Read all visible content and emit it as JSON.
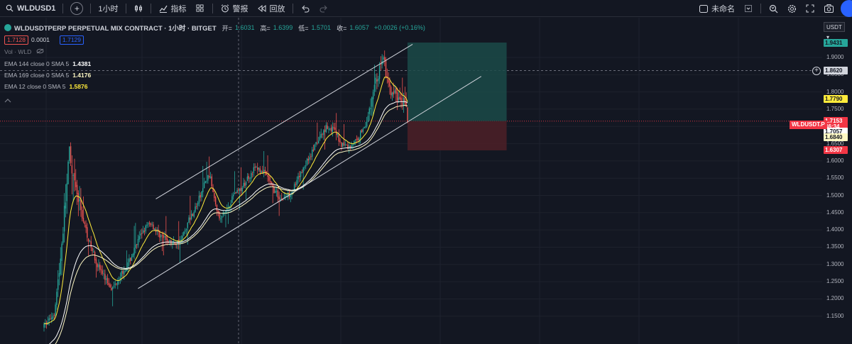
{
  "toolbar": {
    "symbol": "WLDUSD1",
    "interval": "1小时",
    "indicators_label": "指标",
    "alert_label": "警报",
    "replay_label": "回放",
    "layout_name": "未命名"
  },
  "legend": {
    "title": "WLDUSDTPERP PERPETUAL MIX CONTRACT · 1小时 · BITGET",
    "open_label": "开=",
    "open": "1.6031",
    "high_label": "高=",
    "high": "1.6399",
    "low_label": "低=",
    "low": "1.5701",
    "close_label": "收=",
    "close": "1.6057",
    "change": "+0.0026 (+0.16%)",
    "sell_price": "1.7128",
    "spread": "0.0001",
    "buy_price": "1.7129",
    "volume_label": "Vol · WLD",
    "indicators": [
      {
        "text": "EMA 144 close 0 SMA 5",
        "value": "1.4381",
        "color": "#ffffff"
      },
      {
        "text": "EMA 169 close 0 SMA 5",
        "value": "1.4176",
        "color": "#fff9c4"
      },
      {
        "text": "EMA 12 close 0 SMA 5",
        "value": "1.5876",
        "color": "#ffeb3b"
      }
    ]
  },
  "price_axis": {
    "currency": "USDT",
    "ticks": [
      "1.9000",
      "1.8500",
      "1.8000",
      "1.7500",
      "1.6500",
      "1.6000",
      "1.5500",
      "1.5000",
      "1.4500",
      "1.4000",
      "1.3500",
      "1.3000",
      "1.2500",
      "1.2000",
      "1.1500"
    ],
    "labels": [
      {
        "text": "1.9431",
        "bg": "#26a69a",
        "fg": "#131722",
        "y": 1.9431
      },
      {
        "text": "1.8620",
        "bg": "#d1d4dc",
        "fg": "#131722",
        "y": 1.862
      },
      {
        "text": "1.7790",
        "bg": "#ffeb3b",
        "fg": "#131722",
        "y": 1.779
      },
      {
        "text": "1.7157",
        "bg": "#787b86",
        "fg": "#ffffff",
        "y": 1.7157
      },
      {
        "text": "1.7153",
        "bg": "#f23645",
        "fg": "#ffffff",
        "y": 1.7153
      },
      {
        "text": "46:34",
        "bg": "#f23645",
        "fg": "#ffffff",
        "y": 1.7
      },
      {
        "text": "1.7057",
        "bg": "#ffffff",
        "fg": "#131722",
        "y": 1.685
      },
      {
        "text": "1.6840",
        "bg": "#fff9c4",
        "fg": "#131722",
        "y": 1.6695
      },
      {
        "text": "1.6307",
        "bg": "#f23645",
        "fg": "#ffffff",
        "y": 1.6307
      }
    ],
    "symbol_tag": "WLDUSDT.P"
  },
  "colors": {
    "background": "#131722",
    "up": "#26a69a",
    "down": "#ef5350",
    "ema12": "#ffeb3b",
    "ema144": "#ffffff",
    "ema169": "#fff9c4",
    "target_zone": "#1b4a48",
    "stop_zone": "#4a1f27"
  },
  "chart_data": {
    "type": "candlestick",
    "title": "WLDUSDTPERP PERPETUAL MIX CONTRACT · 1小时 · BITGET",
    "ylim": [
      1.12,
      1.99
    ],
    "price_trend": [
      [
        0,
        1.12
      ],
      [
        8,
        1.16
      ],
      [
        12,
        1.28
      ],
      [
        16,
        1.45
      ],
      [
        20,
        1.62
      ],
      [
        22,
        1.55
      ],
      [
        26,
        1.5
      ],
      [
        30,
        1.44
      ],
      [
        36,
        1.36
      ],
      [
        42,
        1.3
      ],
      [
        48,
        1.26
      ],
      [
        54,
        1.23
      ],
      [
        60,
        1.27
      ],
      [
        66,
        1.3
      ],
      [
        72,
        1.35
      ],
      [
        78,
        1.4
      ],
      [
        84,
        1.42
      ],
      [
        90,
        1.39
      ],
      [
        96,
        1.37
      ],
      [
        102,
        1.36
      ],
      [
        108,
        1.37
      ],
      [
        114,
        1.43
      ],
      [
        120,
        1.47
      ],
      [
        126,
        1.53
      ],
      [
        130,
        1.56
      ],
      [
        134,
        1.5
      ],
      [
        138,
        1.43
      ],
      [
        144,
        1.46
      ],
      [
        150,
        1.51
      ],
      [
        156,
        1.52
      ],
      [
        160,
        1.55
      ],
      [
        166,
        1.58
      ],
      [
        172,
        1.57
      ],
      [
        176,
        1.55
      ],
      [
        180,
        1.52
      ],
      [
        186,
        1.49
      ],
      [
        192,
        1.5
      ],
      [
        198,
        1.53
      ],
      [
        204,
        1.58
      ],
      [
        210,
        1.62
      ],
      [
        216,
        1.66
      ],
      [
        222,
        1.7
      ],
      [
        228,
        1.69
      ],
      [
        234,
        1.65
      ],
      [
        240,
        1.64
      ],
      [
        246,
        1.66
      ],
      [
        252,
        1.7
      ],
      [
        256,
        1.74
      ],
      [
        260,
        1.82
      ],
      [
        264,
        1.86
      ],
      [
        266,
        1.9
      ],
      [
        268,
        1.88
      ],
      [
        270,
        1.83
      ],
      [
        272,
        1.8
      ],
      [
        276,
        1.79
      ],
      [
        280,
        1.78
      ],
      [
        284,
        1.78
      ],
      [
        286,
        1.715
      ]
    ],
    "channel_upper": [
      [
        88,
        1.49
      ],
      [
        290,
        1.938
      ]
    ],
    "channel_lower": [
      [
        74,
        1.23
      ],
      [
        344,
        1.845
      ]
    ],
    "position": {
      "entry": 1.7153,
      "target": 1.9431,
      "stop": 1.6307,
      "start_index": 286,
      "end_index": 364
    }
  }
}
